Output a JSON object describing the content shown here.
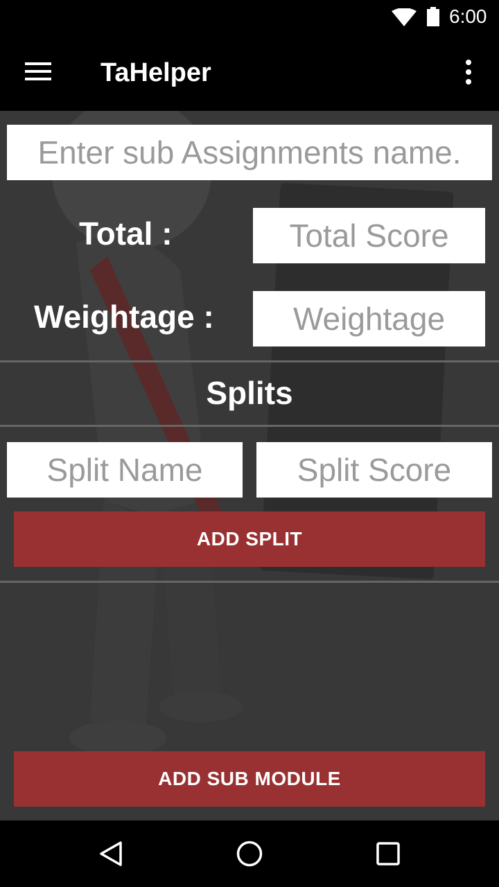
{
  "status_bar": {
    "time": "6:00"
  },
  "app_bar": {
    "title": "TaHelper"
  },
  "form": {
    "assignment_name_placeholder": "Enter sub Assignments name.",
    "total_label": "Total :",
    "total_placeholder": "Total Score",
    "weightage_label": "Weightage :",
    "weightage_placeholder": "Weightage"
  },
  "splits": {
    "heading": "Splits",
    "split_name_placeholder": "Split Name",
    "split_score_placeholder": "Split Score",
    "add_split_label": "ADD SPLIT"
  },
  "footer": {
    "add_sub_module_label": "ADD SUB MODULE"
  },
  "colors": {
    "accent": "#993132",
    "background": "#383838",
    "bar": "#000000"
  }
}
